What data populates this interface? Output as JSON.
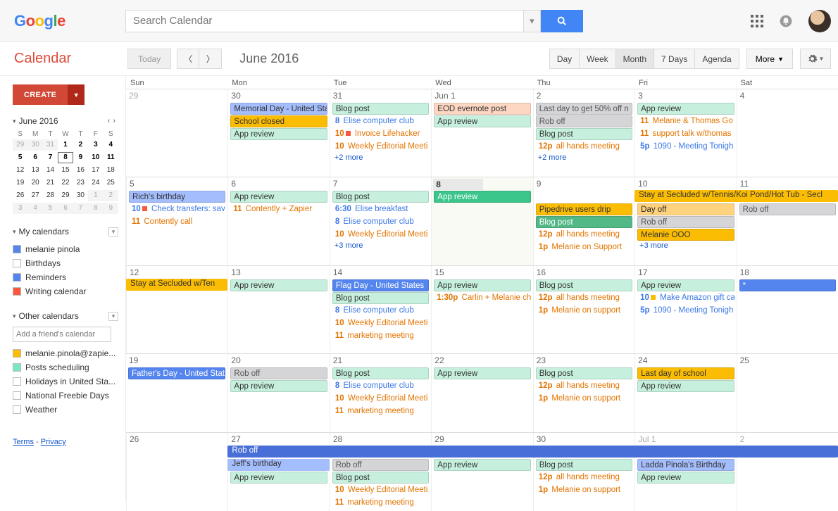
{
  "search": {
    "placeholder": "Search Calendar"
  },
  "app_name": "Calendar",
  "today_label": "Today",
  "period_title": "June 2016",
  "views": [
    "Day",
    "Week",
    "Month",
    "7 Days",
    "Agenda"
  ],
  "active_view": "Month",
  "more_label": "More",
  "create_label": "CREATE",
  "mini": {
    "title": "June 2016",
    "dow": [
      "S",
      "M",
      "T",
      "W",
      "T",
      "F",
      "S"
    ],
    "cells": [
      {
        "n": "29",
        "cls": "out"
      },
      {
        "n": "30",
        "cls": "out"
      },
      {
        "n": "31",
        "cls": "out"
      },
      {
        "n": "1",
        "cls": "bold"
      },
      {
        "n": "2",
        "cls": "bold"
      },
      {
        "n": "3",
        "cls": "bold"
      },
      {
        "n": "4",
        "cls": "bold"
      },
      {
        "n": "5",
        "cls": "bold"
      },
      {
        "n": "6",
        "cls": "bold"
      },
      {
        "n": "7",
        "cls": "bold"
      },
      {
        "n": "8",
        "cls": "bold today"
      },
      {
        "n": "9",
        "cls": "bold"
      },
      {
        "n": "10",
        "cls": "bold"
      },
      {
        "n": "11",
        "cls": "bold"
      },
      {
        "n": "12",
        "cls": "in"
      },
      {
        "n": "13",
        "cls": "in"
      },
      {
        "n": "14",
        "cls": "in"
      },
      {
        "n": "15",
        "cls": "in"
      },
      {
        "n": "16",
        "cls": "in"
      },
      {
        "n": "17",
        "cls": "in"
      },
      {
        "n": "18",
        "cls": "in"
      },
      {
        "n": "19",
        "cls": "in"
      },
      {
        "n": "20",
        "cls": "in"
      },
      {
        "n": "21",
        "cls": "in"
      },
      {
        "n": "22",
        "cls": "in"
      },
      {
        "n": "23",
        "cls": "in"
      },
      {
        "n": "24",
        "cls": "in"
      },
      {
        "n": "25",
        "cls": "in"
      },
      {
        "n": "26",
        "cls": "in"
      },
      {
        "n": "27",
        "cls": "in"
      },
      {
        "n": "28",
        "cls": "in"
      },
      {
        "n": "29",
        "cls": "in"
      },
      {
        "n": "30",
        "cls": "in"
      },
      {
        "n": "1",
        "cls": "out"
      },
      {
        "n": "2",
        "cls": "out"
      },
      {
        "n": "3",
        "cls": "out"
      },
      {
        "n": "4",
        "cls": "out"
      },
      {
        "n": "5",
        "cls": "out"
      },
      {
        "n": "6",
        "cls": "out"
      },
      {
        "n": "7",
        "cls": "out"
      },
      {
        "n": "8",
        "cls": "out"
      },
      {
        "n": "9",
        "cls": "out"
      }
    ]
  },
  "my_calendars": {
    "title": "My calendars",
    "items": [
      {
        "label": "melanie pinola",
        "color": "#5484ed",
        "checked": true
      },
      {
        "label": "Birthdays",
        "color": "#ffffff",
        "checked": false
      },
      {
        "label": "Reminders",
        "color": "#5484ed",
        "checked": true
      },
      {
        "label": "Writing calendar",
        "color": "#fa573c",
        "checked": true
      }
    ]
  },
  "other_calendars": {
    "title": "Other calendars",
    "add_placeholder": "Add a friend's calendar",
    "items": [
      {
        "label": "melanie.pinola@zapie...",
        "color": "#fbbc04",
        "checked": true
      },
      {
        "label": "Posts scheduling",
        "color": "#7ae7bf",
        "checked": true
      },
      {
        "label": "Holidays in United Sta...",
        "color": "#ffffff",
        "checked": false
      },
      {
        "label": "National Freebie Days",
        "color": "#ffffff",
        "checked": false
      },
      {
        "label": "Weather",
        "color": "#ffffff",
        "checked": false
      }
    ]
  },
  "footer": {
    "terms": "Terms",
    "privacy": "Privacy"
  },
  "dow": [
    "Sun",
    "Mon",
    "Tue",
    "Wed",
    "Thu",
    "Fri",
    "Sat"
  ],
  "weeks": [
    {
      "spans": [],
      "days": [
        {
          "num": "29",
          "out": true,
          "events": []
        },
        {
          "num": "30",
          "events": [
            {
              "kind": "box",
              "cls": "c-bluebar",
              "text": "Memorial Day - United Sta"
            },
            {
              "kind": "box",
              "cls": "c-orange",
              "text": "School closed"
            },
            {
              "kind": "box",
              "cls": "c-mint",
              "text": "App review"
            }
          ]
        },
        {
          "num": "31",
          "events": [
            {
              "kind": "box",
              "cls": "c-mint",
              "text": "Blog post"
            },
            {
              "kind": "timed",
              "time": "8",
              "timec": "c-bluetxt",
              "text": "Elise computer club"
            },
            {
              "kind": "timed",
              "time": "10",
              "timec": "c-orangetxt",
              "sq": "#fa573c",
              "text": "Invoice Lifehacker"
            },
            {
              "kind": "timed",
              "time": "10",
              "timec": "c-orangetxt",
              "text": "Weekly Editorial Meeti"
            },
            {
              "kind": "more",
              "text": "+2 more"
            }
          ]
        },
        {
          "num": "Jun 1",
          "events": [
            {
              "kind": "box",
              "cls": "c-peach",
              "text": "EOD evernote post"
            },
            {
              "kind": "box",
              "cls": "c-mint",
              "text": "App review"
            }
          ]
        },
        {
          "num": "2",
          "events": [
            {
              "kind": "box",
              "cls": "c-grey",
              "text": "Last day to get 50% off n"
            },
            {
              "kind": "box",
              "cls": "c-grey",
              "text": "Rob off"
            },
            {
              "kind": "box",
              "cls": "c-mint",
              "text": "Blog post"
            },
            {
              "kind": "timed",
              "time": "12p",
              "timec": "c-orangetxt",
              "text": "all hands meeting"
            },
            {
              "kind": "more",
              "text": "+2 more"
            }
          ]
        },
        {
          "num": "3",
          "events": [
            {
              "kind": "box",
              "cls": "c-mint",
              "text": "App review"
            },
            {
              "kind": "timed",
              "time": "11",
              "timec": "c-orangetxt",
              "text": "Melanie & Thomas Go"
            },
            {
              "kind": "timed",
              "time": "11",
              "timec": "c-orangetxt",
              "text": "support talk w/thomas"
            },
            {
              "kind": "timed",
              "time": "5p",
              "timec": "c-bluetxt",
              "text": "1090 - Meeting Tonigh"
            }
          ]
        },
        {
          "num": "4",
          "events": []
        }
      ]
    },
    {
      "spans": [
        {
          "start": 5,
          "end": 7,
          "row": "rowA",
          "cls": "c-orange",
          "text": "Stay at Secluded w/Tennis/Koi Pond/Hot Tub - Secl"
        }
      ],
      "days": [
        {
          "num": "5",
          "events": [
            {
              "kind": "box",
              "cls": "c-bluebar",
              "text": "Rich's birthday"
            },
            {
              "kind": "timed",
              "time": "10",
              "timec": "c-bluetxt",
              "sq": "#fa573c",
              "text": "Check transfers: sav"
            },
            {
              "kind": "timed",
              "time": "11",
              "timec": "c-orangetxt",
              "text": "Contently call"
            }
          ]
        },
        {
          "num": "6",
          "events": [
            {
              "kind": "box",
              "cls": "c-mint",
              "text": "App review"
            },
            {
              "kind": "timed",
              "time": "11",
              "timec": "c-orangetxt",
              "text": "Contently + Zapier"
            }
          ]
        },
        {
          "num": "7",
          "events": [
            {
              "kind": "box",
              "cls": "c-mint",
              "text": "Blog post"
            },
            {
              "kind": "timed",
              "time": "6:30",
              "timec": "c-bluetxt",
              "text": "Elise breakfast"
            },
            {
              "kind": "timed",
              "time": "8",
              "timec": "c-bluetxt",
              "text": "Elise computer club"
            },
            {
              "kind": "timed",
              "time": "10",
              "timec": "c-orangetxt",
              "text": "Weekly Editorial Meeti"
            },
            {
              "kind": "more",
              "text": "+3 more"
            }
          ]
        },
        {
          "num": "8",
          "today": true,
          "events": [
            {
              "kind": "box",
              "cls": "c-mintdark2",
              "text": "App review"
            }
          ]
        },
        {
          "num": "9",
          "events": [
            {
              "kind": "gap"
            },
            {
              "kind": "box",
              "cls": "c-orange",
              "text": "Pipedrive users drip"
            },
            {
              "kind": "box",
              "cls": "c-mintdark",
              "text": "Blog post"
            },
            {
              "kind": "timed",
              "time": "12p",
              "timec": "c-orangetxt",
              "text": "all hands meeting"
            },
            {
              "kind": "timed",
              "time": "1p",
              "timec": "c-orangetxt",
              "text": "Melanie on Support"
            }
          ]
        },
        {
          "num": "10",
          "events": [
            {
              "kind": "gap"
            },
            {
              "kind": "box",
              "cls": "c-orange-note",
              "text": "Day off"
            },
            {
              "kind": "box",
              "cls": "c-grey",
              "text": "Rob off"
            },
            {
              "kind": "box",
              "cls": "c-orange",
              "text": "Melanie OOO"
            },
            {
              "kind": "more",
              "text": "+3 more"
            }
          ]
        },
        {
          "num": "11",
          "events": [
            {
              "kind": "gap"
            },
            {
              "kind": "box",
              "cls": "c-grey",
              "text": "Rob off"
            }
          ]
        }
      ]
    },
    {
      "spans": [
        {
          "start": 0,
          "end": 1,
          "row": "rowA",
          "cls": "c-orange",
          "text": "Stay at Secluded w/Ten",
          "arrow": true
        }
      ],
      "days": [
        {
          "num": "12",
          "events": [
            {
              "kind": "gap"
            }
          ]
        },
        {
          "num": "13",
          "events": [
            {
              "kind": "box",
              "cls": "c-mint",
              "text": "App review"
            }
          ]
        },
        {
          "num": "14",
          "events": [
            {
              "kind": "box",
              "cls": "c-blue",
              "text": "Flag Day - United States"
            },
            {
              "kind": "box",
              "cls": "c-mint",
              "text": "Blog post"
            },
            {
              "kind": "timed",
              "time": "8",
              "timec": "c-bluetxt",
              "text": "Elise computer club"
            },
            {
              "kind": "timed",
              "time": "10",
              "timec": "c-orangetxt",
              "text": "Weekly Editorial Meeti"
            },
            {
              "kind": "timed",
              "time": "11",
              "timec": "c-orangetxt",
              "text": "marketing meeting"
            }
          ]
        },
        {
          "num": "15",
          "events": [
            {
              "kind": "box",
              "cls": "c-mint",
              "text": "App review"
            },
            {
              "kind": "timed",
              "time": "1:30p",
              "timec": "c-orangetxt",
              "text": "Carlin + Melanie ch"
            }
          ]
        },
        {
          "num": "16",
          "events": [
            {
              "kind": "box",
              "cls": "c-mint",
              "text": "Blog post"
            },
            {
              "kind": "timed",
              "time": "12p",
              "timec": "c-orangetxt",
              "text": "all hands meeting"
            },
            {
              "kind": "timed",
              "time": "1p",
              "timec": "c-orangetxt",
              "text": "Melanie on support"
            }
          ]
        },
        {
          "num": "17",
          "events": [
            {
              "kind": "box",
              "cls": "c-mint",
              "text": "App review"
            },
            {
              "kind": "timed",
              "time": "10",
              "timec": "c-bluetxt",
              "sq": "#fbbc04",
              "text": "Make Amazon gift ca"
            },
            {
              "kind": "timed",
              "time": "5p",
              "timec": "c-bluetxt",
              "text": "1090 - Meeting Tonigh"
            }
          ]
        },
        {
          "num": "18",
          "events": [
            {
              "kind": "box",
              "cls": "c-blue",
              "text": "*"
            }
          ]
        }
      ]
    },
    {
      "spans": [],
      "days": [
        {
          "num": "19",
          "events": [
            {
              "kind": "box",
              "cls": "c-blue",
              "text": "Father's Day - United State"
            }
          ]
        },
        {
          "num": "20",
          "events": [
            {
              "kind": "box",
              "cls": "c-grey",
              "text": "Rob off"
            },
            {
              "kind": "box",
              "cls": "c-mint",
              "text": "App review"
            }
          ]
        },
        {
          "num": "21",
          "events": [
            {
              "kind": "box",
              "cls": "c-mint",
              "text": "Blog post"
            },
            {
              "kind": "timed",
              "time": "8",
              "timec": "c-bluetxt",
              "text": "Elise computer club"
            },
            {
              "kind": "timed",
              "time": "10",
              "timec": "c-orangetxt",
              "text": "Weekly Editorial Meeti"
            },
            {
              "kind": "timed",
              "time": "11",
              "timec": "c-orangetxt",
              "text": "marketing meeting"
            }
          ]
        },
        {
          "num": "22",
          "events": [
            {
              "kind": "box",
              "cls": "c-mint",
              "text": "App review"
            }
          ]
        },
        {
          "num": "23",
          "events": [
            {
              "kind": "box",
              "cls": "c-mint",
              "text": "Blog post"
            },
            {
              "kind": "timed",
              "time": "12p",
              "timec": "c-orangetxt",
              "text": "all hands meeting"
            },
            {
              "kind": "timed",
              "time": "1p",
              "timec": "c-orangetxt",
              "text": "Melanie on support"
            }
          ]
        },
        {
          "num": "24",
          "events": [
            {
              "kind": "box",
              "cls": "c-orange",
              "text": "Last day of school"
            },
            {
              "kind": "box",
              "cls": "c-mint",
              "text": "App review"
            }
          ]
        },
        {
          "num": "25",
          "events": []
        }
      ]
    },
    {
      "spans": [
        {
          "start": 1,
          "end": 7,
          "row": "rowA",
          "cls": "c-blue2",
          "text": "Rob off"
        },
        {
          "start": 1,
          "end": 2,
          "row": "rowB",
          "cls": "c-bluebar",
          "text": "Jeff's birthday"
        }
      ],
      "days": [
        {
          "num": "26",
          "events": []
        },
        {
          "num": "27",
          "events": [
            {
              "kind": "gap"
            },
            {
              "kind": "gap"
            },
            {
              "kind": "box",
              "cls": "c-mint",
              "text": "App review"
            }
          ]
        },
        {
          "num": "28",
          "events": [
            {
              "kind": "gap"
            },
            {
              "kind": "box",
              "cls": "c-grey",
              "text": "Rob off"
            },
            {
              "kind": "box",
              "cls": "c-mint",
              "text": "Blog post"
            },
            {
              "kind": "timed",
              "time": "10",
              "timec": "c-orangetxt",
              "text": "Weekly Editorial Meeti"
            },
            {
              "kind": "timed",
              "time": "11",
              "timec": "c-orangetxt",
              "text": "marketing meeting"
            }
          ]
        },
        {
          "num": "29",
          "events": [
            {
              "kind": "gap"
            },
            {
              "kind": "box",
              "cls": "c-mint",
              "text": "App review"
            }
          ]
        },
        {
          "num": "30",
          "events": [
            {
              "kind": "gap"
            },
            {
              "kind": "box",
              "cls": "c-mint",
              "text": "Blog post"
            },
            {
              "kind": "timed",
              "time": "12p",
              "timec": "c-orangetxt",
              "text": "all hands meeting"
            },
            {
              "kind": "timed",
              "time": "1p",
              "timec": "c-orangetxt",
              "text": "Melanie on support"
            }
          ]
        },
        {
          "num": "Jul 1",
          "out": true,
          "events": [
            {
              "kind": "gap"
            },
            {
              "kind": "box",
              "cls": "c-bluebar",
              "text": "Ladda Pinola's Birthday"
            },
            {
              "kind": "box",
              "cls": "c-mint",
              "text": "App review"
            }
          ]
        },
        {
          "num": "2",
          "out": true,
          "events": [
            {
              "kind": "gap"
            }
          ]
        }
      ]
    }
  ]
}
